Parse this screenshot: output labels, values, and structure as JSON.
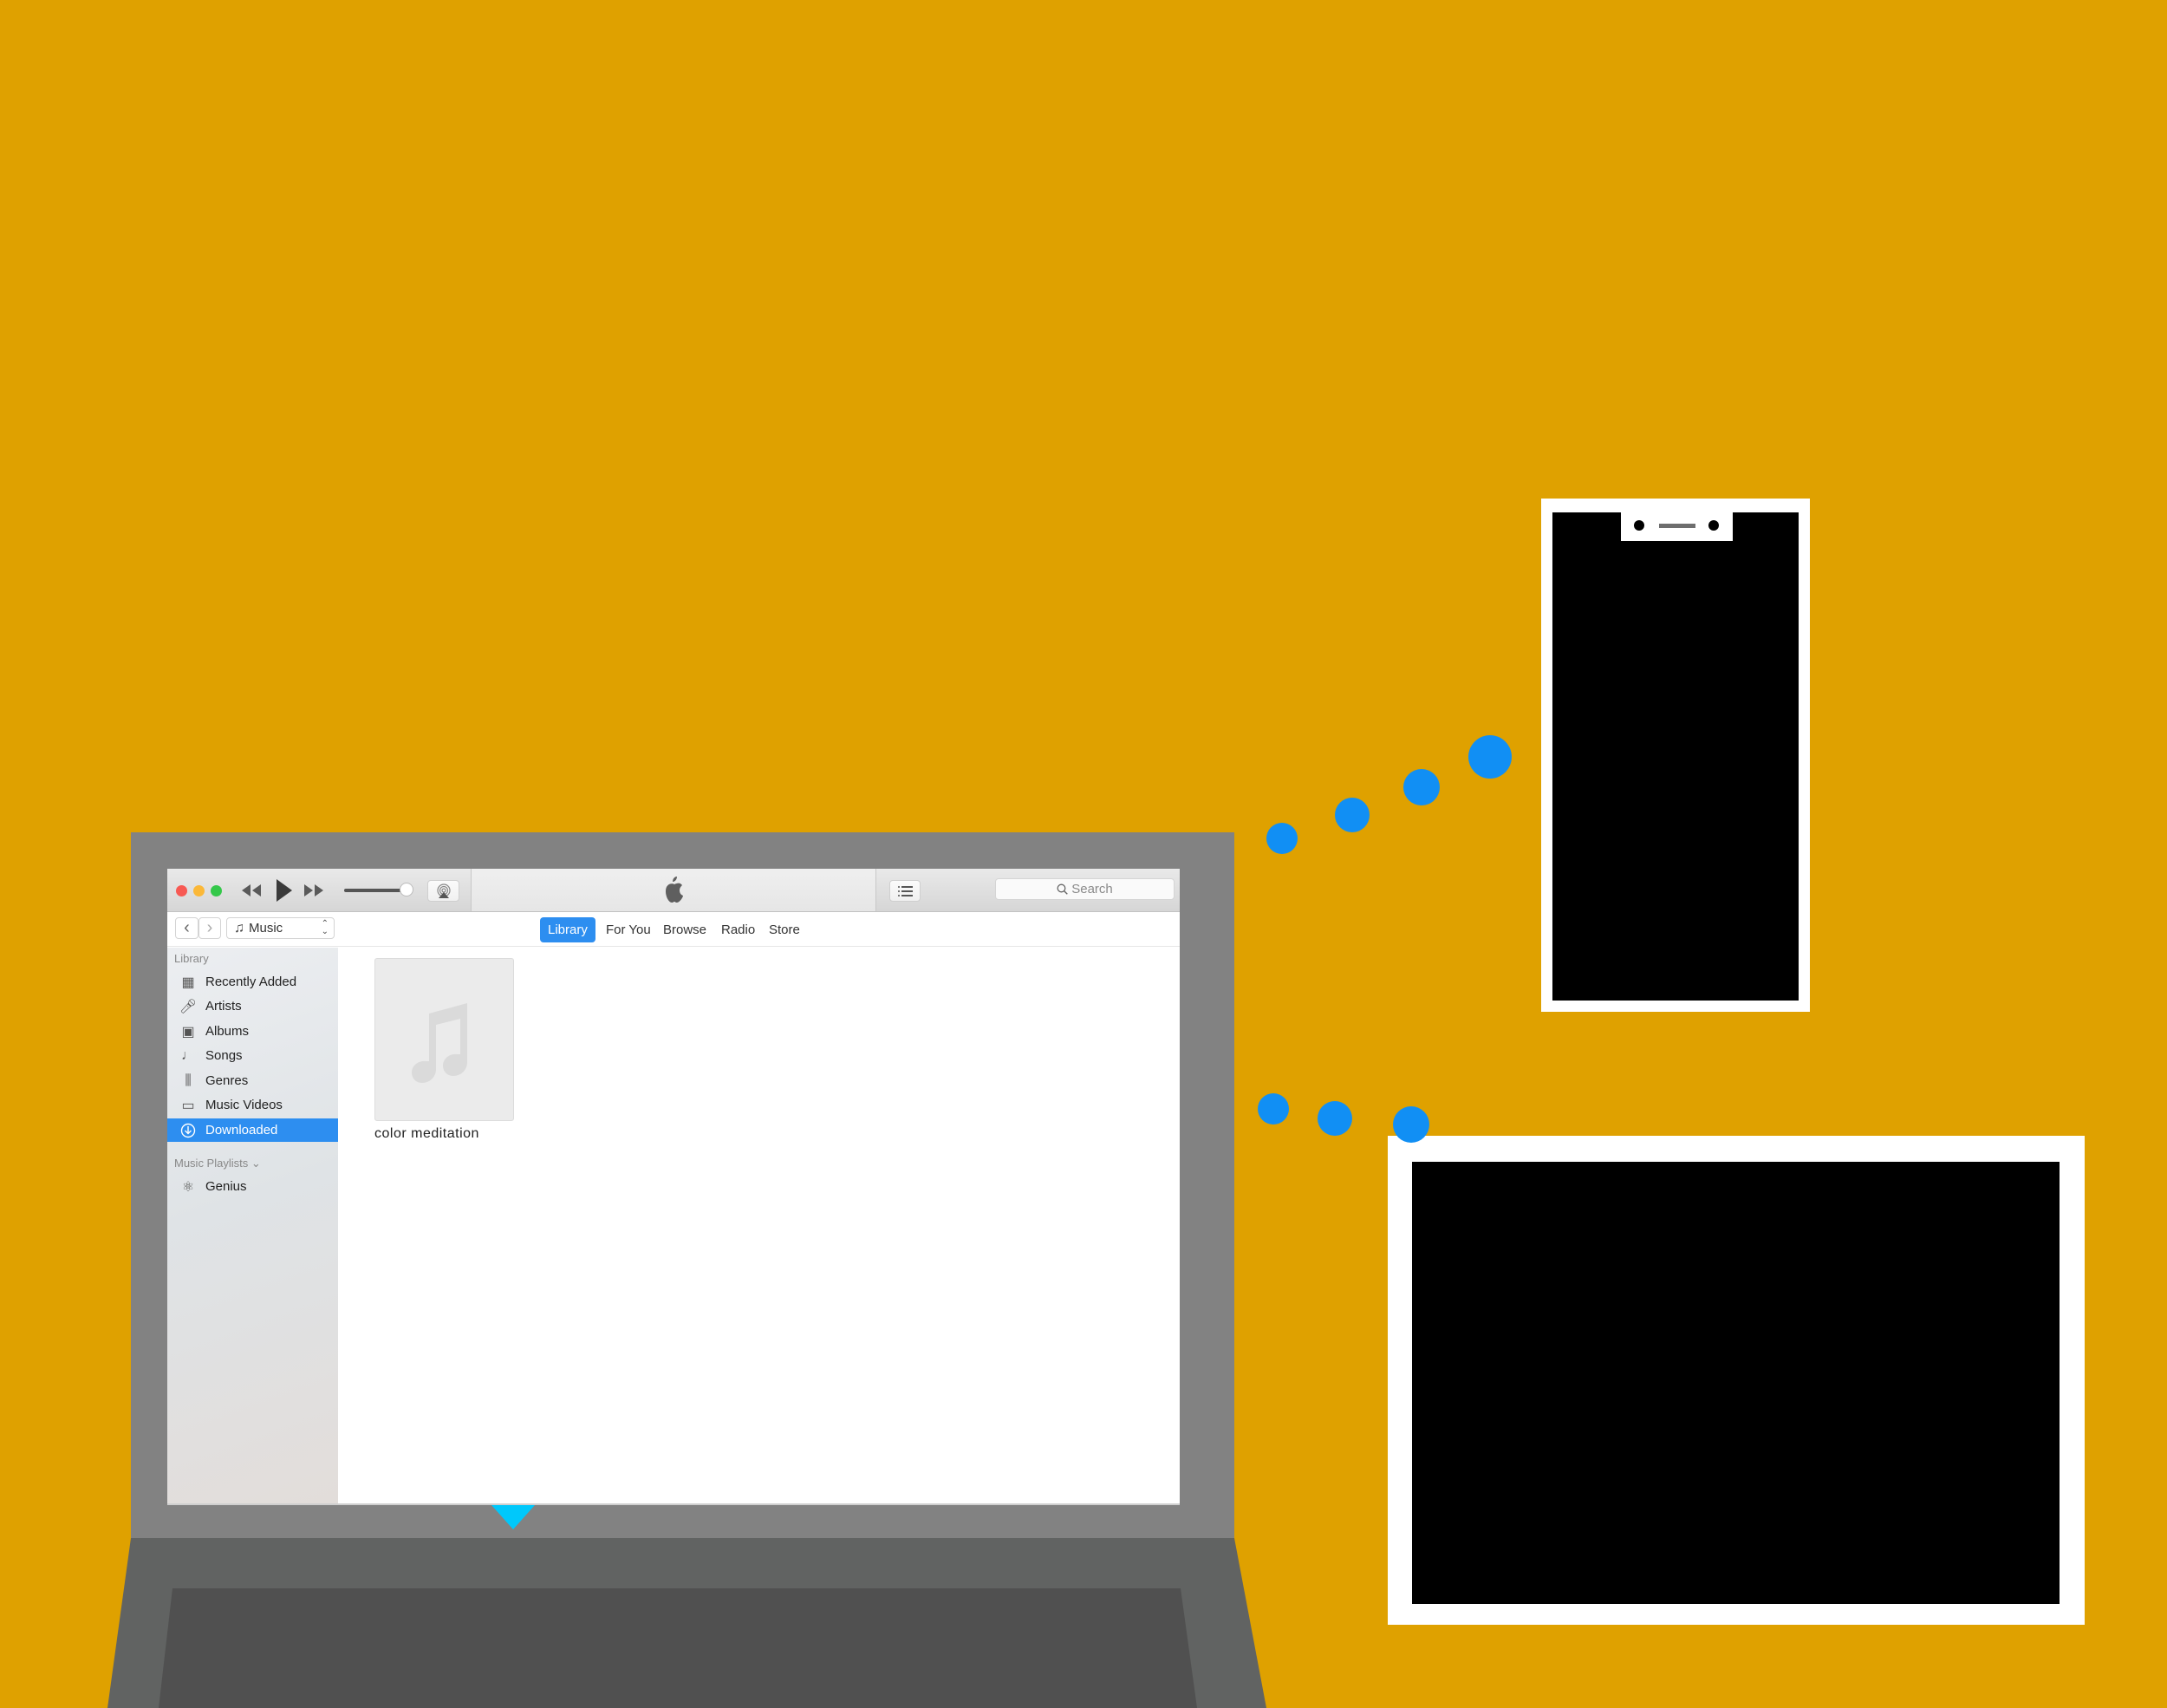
{
  "colors": {
    "background": "#DFA100",
    "accent": "#2d8ef0",
    "connector_dots": "#118ff4",
    "pointer_triangle": "#00c8fb",
    "laptop_lid": "#828282",
    "laptop_base": "#616362",
    "laptop_keyboard": "#505050"
  },
  "window": {
    "toolbar": {
      "traffic_lights": [
        "close",
        "minimize",
        "maximize"
      ],
      "rewind_icon": "rewind-icon",
      "play_icon": "play-icon",
      "fast_forward_icon": "fast-forward-icon",
      "airplay_icon": "airplay-icon",
      "center_logo": "apple-logo-icon",
      "list_icon": "list-view-icon",
      "search_placeholder": "Search"
    },
    "navbar": {
      "back": "‹",
      "forward": "›",
      "media_type": "Music",
      "tabs": [
        {
          "label": "Library",
          "active": true
        },
        {
          "label": "For You",
          "active": false
        },
        {
          "label": "Browse",
          "active": false
        },
        {
          "label": "Radio",
          "active": false
        },
        {
          "label": "Store",
          "active": false
        }
      ]
    },
    "sidebar": {
      "library_heading": "Library",
      "items": [
        {
          "label": "Recently Added",
          "icon": "recently-added-icon"
        },
        {
          "label": "Artists",
          "icon": "microphone-icon"
        },
        {
          "label": "Albums",
          "icon": "albums-icon"
        },
        {
          "label": "Songs",
          "icon": "music-note-icon"
        },
        {
          "label": "Genres",
          "icon": "genres-icon"
        },
        {
          "label": "Music Videos",
          "icon": "music-video-icon"
        },
        {
          "label": "Downloaded",
          "icon": "download-icon",
          "active": true
        }
      ],
      "playlists_heading": "Music Playlists ⌄",
      "playlists": [
        {
          "label": "Genius",
          "icon": "genius-atom-icon"
        }
      ]
    },
    "content": {
      "albums": [
        {
          "title": "color meditation",
          "artwork": "placeholder-music-note"
        }
      ]
    }
  },
  "devices": {
    "phone": {
      "screen": "off"
    },
    "tablet": {
      "screen": "off"
    }
  }
}
